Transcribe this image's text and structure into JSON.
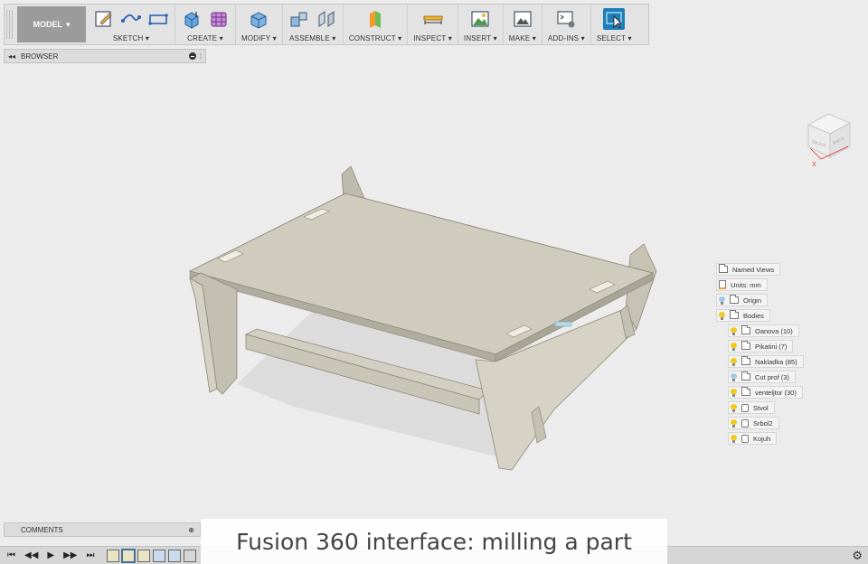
{
  "toolbar": {
    "model_label": "MODEL",
    "groups": [
      {
        "label": "SKETCH"
      },
      {
        "label": "CREATE"
      },
      {
        "label": "MODIFY"
      },
      {
        "label": "ASSEMBLE"
      },
      {
        "label": "CONSTRUCT"
      },
      {
        "label": "INSPECT"
      },
      {
        "label": "INSERT"
      },
      {
        "label": "MAKE"
      },
      {
        "label": "ADD-INS"
      },
      {
        "label": "SELECT"
      }
    ]
  },
  "browser": {
    "title": "BROWSER"
  },
  "viewcube": {
    "faces": [
      "RIGHT",
      "BACK"
    ],
    "axis": "X"
  },
  "tree": {
    "named_views": "Named Views",
    "units": "Units: mm",
    "origin": "Origin",
    "bodies": "Bodies",
    "children": [
      "Oanova (10)",
      "Pikatini (7)",
      "Nakladka (85)",
      "Cut prof (3)",
      "venteljtor (30)",
      "Stvol",
      "Srbol2",
      "Kojuh"
    ]
  },
  "comments": {
    "title": "COMMENTS"
  },
  "caption": "Fusion 360 interface: milling a part",
  "colors": {
    "toolbar_bg": "#e3e3e3",
    "model_btn": "#9b9b9b",
    "part_face": "#cfcbbd",
    "select_blue": "#1d7fb8"
  }
}
